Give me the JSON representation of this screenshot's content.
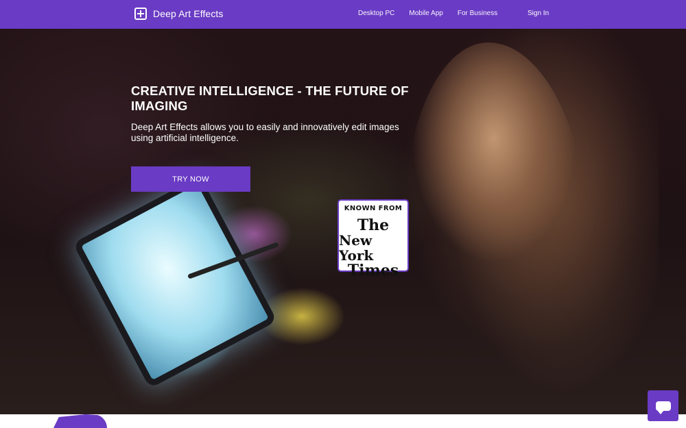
{
  "nav": {
    "brand": "Deep Art Effects",
    "links": [
      "Desktop PC",
      "Mobile App",
      "For Business"
    ],
    "signin": "Sign In"
  },
  "hero": {
    "title": "CREATIVE INTELLIGENCE - THE FUTURE OF IMAGING",
    "subtitle": "Deep Art Effects allows you to easily and innovatively edit images using artificial intelligence.",
    "cta": "TRY NOW"
  },
  "badge": {
    "known_from": "KNOWN FROM",
    "logo_line1": "The",
    "logo_line2": "New York",
    "logo_line3": "Times"
  },
  "icons": {
    "brand": "add-image-icon",
    "chat": "chat-bubble-icon"
  },
  "colors": {
    "accent": "#6a3bc4"
  }
}
